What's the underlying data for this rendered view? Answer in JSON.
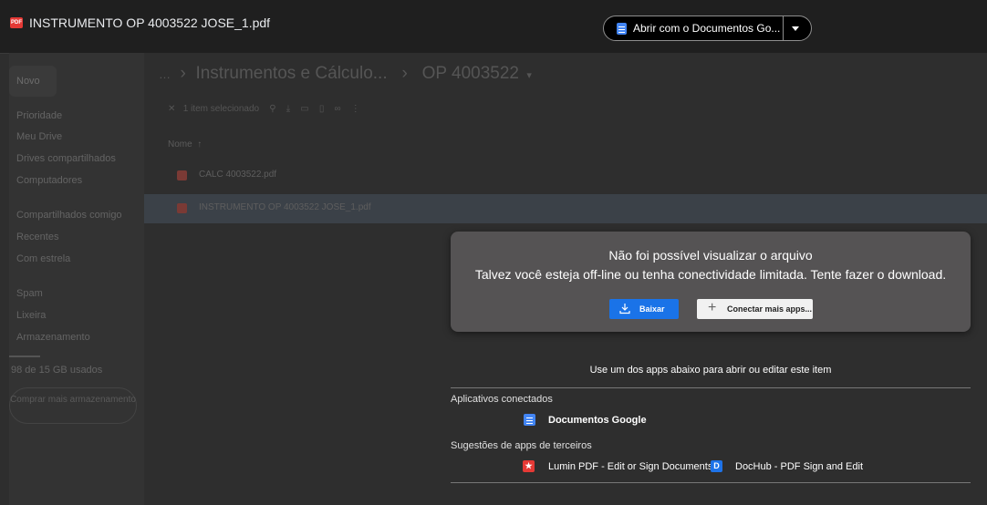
{
  "file": {
    "title": "INSTRUMENTO OP 4003522 JOSE_1.pdf",
    "badge": "PDF"
  },
  "open_with": {
    "label": "Abrir com o Documentos Go..."
  },
  "sidebar": {
    "new_label": "Novo",
    "items": [
      "Prioridade",
      "Meu Drive",
      "Drives compartilhados",
      "Computadores",
      "Compartilhados comigo",
      "Recentes",
      "Com estrela",
      "Spam",
      "Lixeira",
      "Armazenamento"
    ],
    "storage_text": "98 de 15 GB usados",
    "buy_storage": "Comprar mais armazenamento"
  },
  "breadcrumb": {
    "dots": "…",
    "parent": "Instrumentos e Cálculo...",
    "current": "OP 4003522"
  },
  "toolbar": {
    "selected": "1 item selecionado"
  },
  "list": {
    "header": "Nome",
    "files": [
      {
        "name": "CALC 4003522.pdf",
        "selected": false
      },
      {
        "name": "INSTRUMENTO OP 4003522 JOSE_1.pdf",
        "selected": true
      }
    ]
  },
  "dialog": {
    "title": "Não foi possível visualizar o arquivo",
    "message": "Talvez você esteja off-line ou tenha conectividade limitada. Tente fazer o download.",
    "download_label": "Baixar",
    "connect_label": "Conectar mais apps..."
  },
  "apps": {
    "hint": "Use um dos apps abaixo para abrir ou editar este item",
    "connected_title": "Aplicativos conectados",
    "connected": [
      {
        "name": "Documentos Google",
        "icon": "docs-icon"
      }
    ],
    "suggested_title": "Sugestões de apps de terceiros",
    "suggested": [
      {
        "name": "Lumin PDF - Edit or Sign Documents",
        "icon": "lumin-icon",
        "glyph": "★"
      },
      {
        "name": "DocHub - PDF Sign and Edit",
        "icon": "dochub-icon",
        "glyph": "D"
      }
    ]
  },
  "colors": {
    "accent": "#1a73e8",
    "pdf_red": "#e53935",
    "docs_blue": "#4285f4"
  }
}
